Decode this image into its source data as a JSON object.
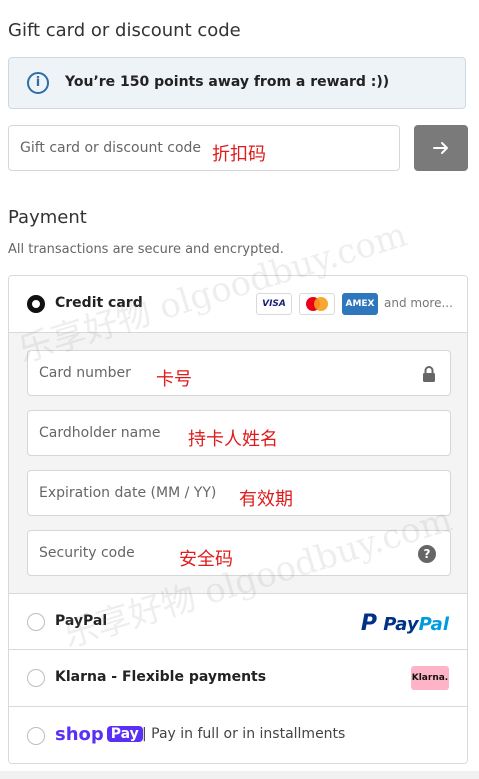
{
  "gift": {
    "title": "Gift card or discount code",
    "info_text": "You’re 150 points away from a reward :))",
    "input_placeholder": "Gift card or discount code",
    "annotation": "折扣码",
    "apply_icon": "arrow-right-icon"
  },
  "payment": {
    "title": "Payment",
    "subtitle": "All transactions are secure and encrypted.",
    "credit_card": {
      "label": "Credit card",
      "logos": [
        "VISA",
        "Mastercard",
        "AMEX"
      ],
      "and_more": "and more...",
      "fields": [
        {
          "placeholder": "Card number",
          "annotation": "卡号",
          "icon": "lock-icon"
        },
        {
          "placeholder": "Cardholder name",
          "annotation": "持卡人姓名"
        },
        {
          "placeholder": "Expiration date (MM / YY)",
          "annotation": "有效期"
        },
        {
          "placeholder": "Security code",
          "annotation": "安全码",
          "icon": "help-icon"
        }
      ]
    },
    "paypal": {
      "label": "PayPal",
      "logo_text_1": "Pay",
      "logo_text_2": "Pal"
    },
    "klarna": {
      "label": "Klarna - Flexible payments",
      "logo_text": "Klarna."
    },
    "shop_pay": {
      "logo_shop": "shop",
      "logo_pay": "Pay",
      "text": "| Pay in full or in installments"
    }
  },
  "watermark": {
    "text": "乐享好物 olgoodbuy.com"
  },
  "colors": {
    "accent_blue": "#2c6ea7",
    "annotation_red": "#e01b1b",
    "shop_purple": "#5a31f4",
    "klarna_pink": "#ffb3c7"
  }
}
